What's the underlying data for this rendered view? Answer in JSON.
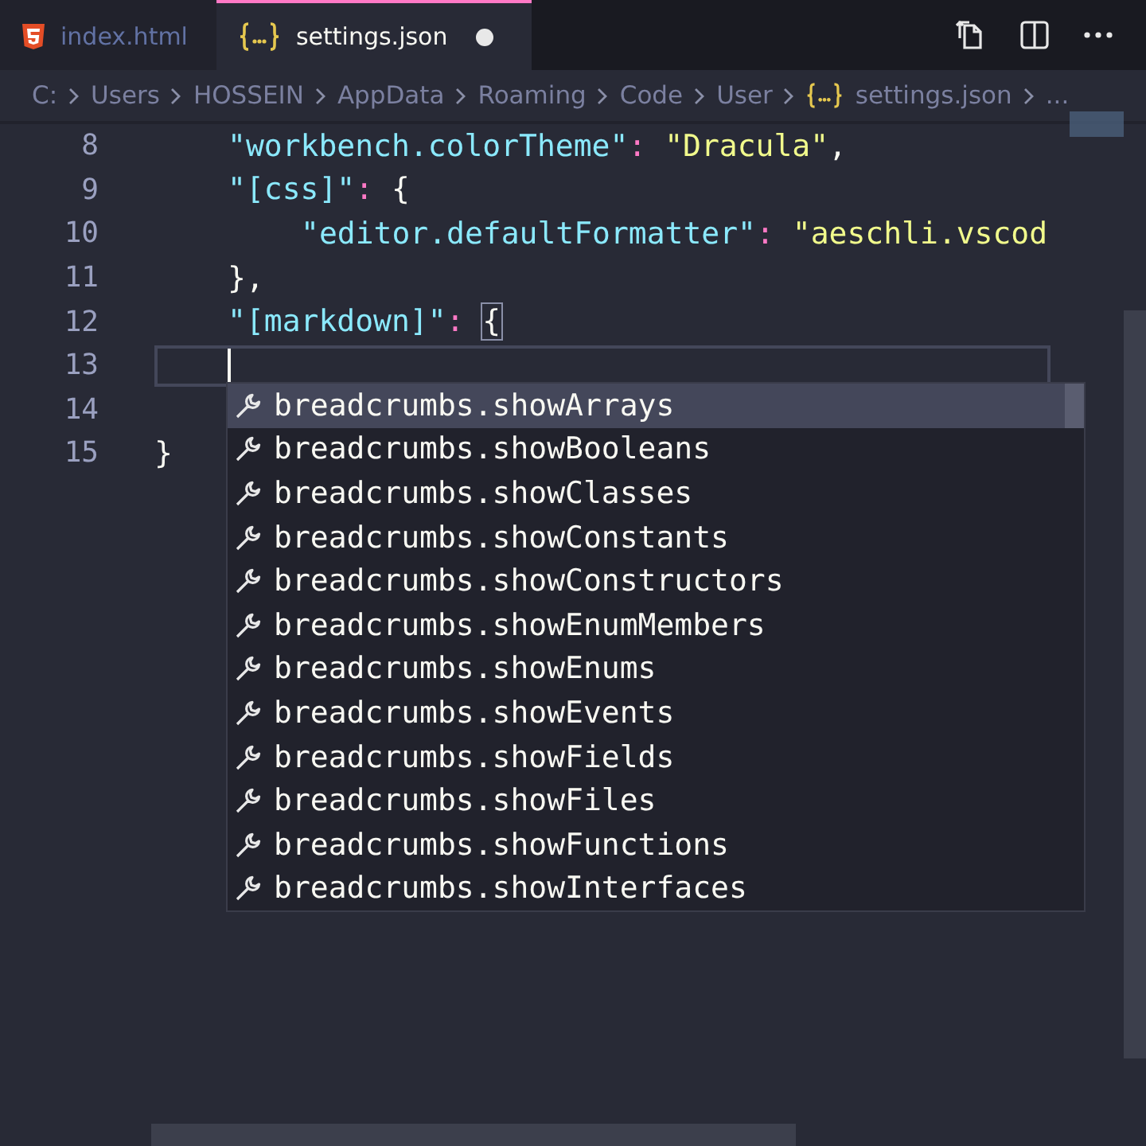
{
  "tabs": [
    {
      "label": "index.html",
      "kind": "html",
      "selected": false,
      "modified": false
    },
    {
      "label": "settings.json",
      "kind": "json",
      "selected": true,
      "modified": true
    }
  ],
  "breadcrumbs": [
    {
      "label": "C:",
      "kind": "folder"
    },
    {
      "label": "Users",
      "kind": "folder"
    },
    {
      "label": "HOSSEIN",
      "kind": "folder"
    },
    {
      "label": "AppData",
      "kind": "folder"
    },
    {
      "label": "Roaming",
      "kind": "folder"
    },
    {
      "label": "Code",
      "kind": "folder"
    },
    {
      "label": "User",
      "kind": "folder"
    },
    {
      "label": "settings.json",
      "kind": "json"
    },
    {
      "label": "...",
      "kind": "more"
    }
  ],
  "editor": {
    "lines": [
      {
        "children": [
          {
            "number": "8",
            "current": false,
            "tokens": [
              {
                "text": "\"workbench.colorTheme\"",
                "kind": "key"
              },
              {
                "text": ": ",
                "kind": "colon"
              },
              {
                "text": "\"Dracula\"",
                "kind": "string"
              },
              {
                "text": ",",
                "kind": "punct"
              }
            ]
          },
          {
            "number": "9",
            "current": false,
            "tokens": [
              {
                "text": "\"[css]\"",
                "kind": "key"
              },
              {
                "text": ": ",
                "kind": "colon"
              },
              {
                "text": "{",
                "kind": "punct"
              }
            ],
            "children": [
              {
                "number": "10",
                "current": false,
                "tokens": [
                  {
                    "text": "\"editor.defaultFormatter\"",
                    "kind": "key"
                  },
                  {
                    "text": ": ",
                    "kind": "colon"
                  },
                  {
                    "text": "\"aeschli.vscod",
                    "kind": "string"
                  }
                ]
              }
            ]
          },
          {
            "number": "11",
            "current": false,
            "tokens": [
              {
                "text": "},",
                "kind": "punct"
              }
            ]
          },
          {
            "number": "12",
            "current": false,
            "tokens": [
              {
                "text": "\"[markdown]\"",
                "kind": "key"
              },
              {
                "text": ": ",
                "kind": "colon"
              },
              {
                "text": "{",
                "kind": "bracket-match"
              }
            ]
          },
          {
            "number": "13",
            "current": true
          },
          {
            "number": "14",
            "current": false
          }
        ]
      },
      {
        "number": "15",
        "current": false,
        "tokens": [
          {
            "text": "}",
            "kind": "punct"
          }
        ]
      }
    ]
  },
  "suggestions": [
    {
      "label": "breadcrumbs.showArrays",
      "selected": true
    },
    {
      "label": "breadcrumbs.showBooleans",
      "selected": false
    },
    {
      "label": "breadcrumbs.showClasses",
      "selected": false
    },
    {
      "label": "breadcrumbs.showConstants",
      "selected": false
    },
    {
      "label": "breadcrumbs.showConstructors",
      "selected": false
    },
    {
      "label": "breadcrumbs.showEnumMembers",
      "selected": false
    },
    {
      "label": "breadcrumbs.showEnums",
      "selected": false
    },
    {
      "label": "breadcrumbs.showEvents",
      "selected": false
    },
    {
      "label": "breadcrumbs.showFields",
      "selected": false
    },
    {
      "label": "breadcrumbs.showFiles",
      "selected": false
    },
    {
      "label": "breadcrumbs.showFunctions",
      "selected": false
    },
    {
      "label": "breadcrumbs.showInterfaces",
      "selected": false
    }
  ]
}
